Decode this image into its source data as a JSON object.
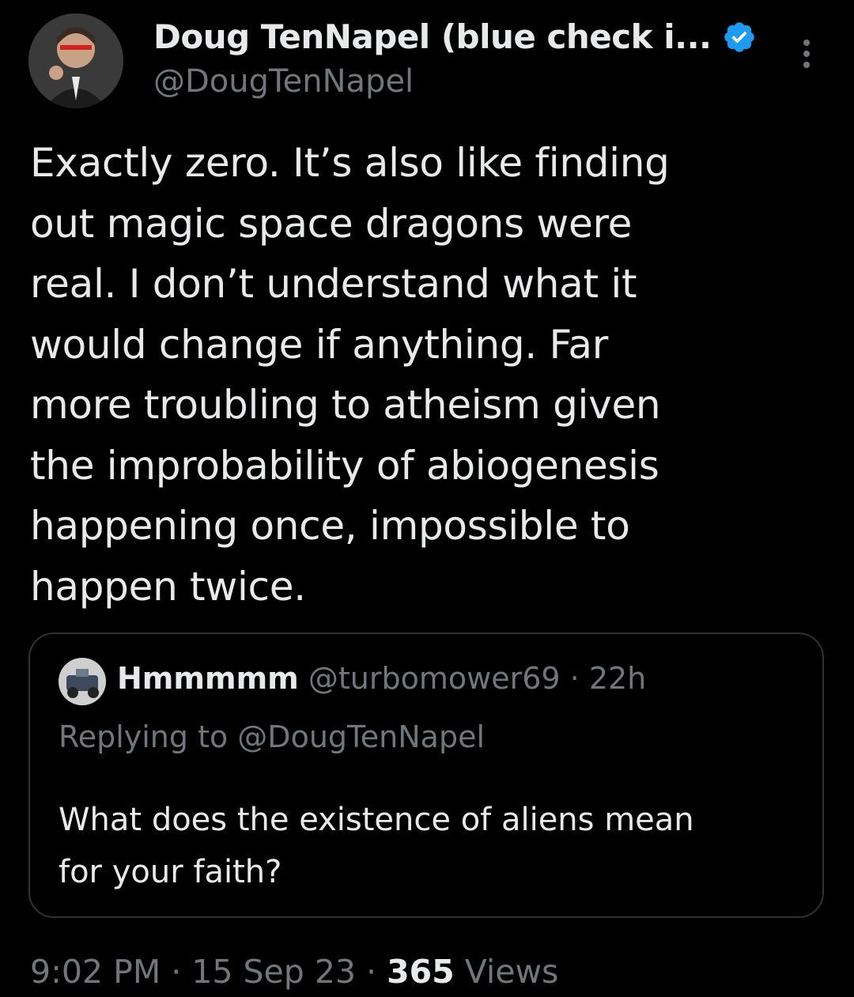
{
  "author": {
    "display_name": "Doug TenNapel (blue check i...",
    "handle": "@DougTenNapel",
    "verified_icon": "verified-badge-icon",
    "verified_color": "#1d9bf0",
    "avatar": "author-avatar"
  },
  "menu": {
    "icon": "more-options-icon"
  },
  "tweet": {
    "text": "Exactly zero. It’s also like finding\nout magic space dragons were\nreal. I don’t understand what it\nwould change if anything. Far\nmore troubling to atheism given\nthe improbability of abiogenesis\nhappening once, impossible to\nhappen twice."
  },
  "quoted_tweet": {
    "display_name": "Hmmmmm",
    "handle": "@turbomower69",
    "separator": " · ",
    "time": "22h",
    "replying_to": "Replying to @DougTenNapel",
    "text": "What does the existence of aliens mean\nfor your faith?"
  },
  "meta": {
    "time": "9:02 PM",
    "sep1": " · ",
    "date": "15 Sep 23",
    "sep2": " · ",
    "views_count": "365",
    "views_label": " Views"
  },
  "colors": {
    "background": "#000000",
    "primary_text": "#e7e9ea",
    "secondary_text": "#71767b",
    "border": "#2f3336",
    "accent": "#1d9bf0"
  }
}
